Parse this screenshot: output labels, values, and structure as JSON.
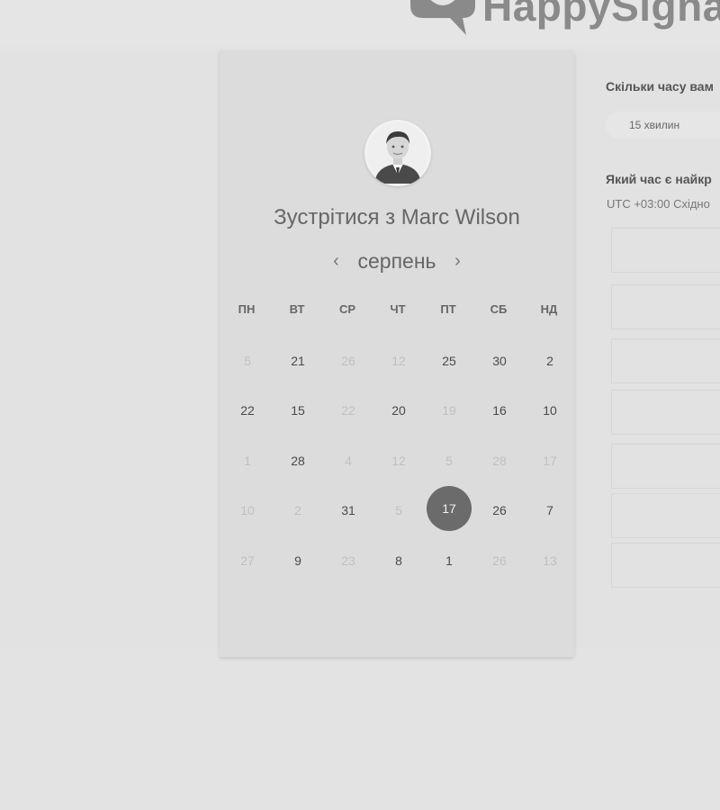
{
  "brand": {
    "name": "HappySignal"
  },
  "booking": {
    "title": "Зустрітися з Marc Wilson",
    "month": "серпень",
    "prev_icon": "‹",
    "next_icon": "›",
    "weekdays": [
      "ПН",
      "ВТ",
      "СР",
      "ЧТ",
      "ПТ",
      "СБ",
      "НД"
    ],
    "days": [
      {
        "label": "5",
        "available": false
      },
      {
        "label": "21",
        "available": true
      },
      {
        "label": "26",
        "available": false
      },
      {
        "label": "12",
        "available": false
      },
      {
        "label": "25",
        "available": true
      },
      {
        "label": "30",
        "available": true
      },
      {
        "label": "2",
        "available": true
      },
      {
        "label": "22",
        "available": true
      },
      {
        "label": "15",
        "available": true
      },
      {
        "label": "22",
        "available": false
      },
      {
        "label": "20",
        "available": true
      },
      {
        "label": "19",
        "available": false
      },
      {
        "label": "16",
        "available": true
      },
      {
        "label": "10",
        "available": true
      },
      {
        "label": "1",
        "available": false
      },
      {
        "label": "28",
        "available": true
      },
      {
        "label": "4",
        "available": false
      },
      {
        "label": "12",
        "available": false
      },
      {
        "label": "5",
        "available": false
      },
      {
        "label": "28",
        "available": false
      },
      {
        "label": "17",
        "available": false
      },
      {
        "label": "10",
        "available": false
      },
      {
        "label": "2",
        "available": false
      },
      {
        "label": "31",
        "available": true
      },
      {
        "label": "5",
        "available": false
      },
      {
        "label": "17",
        "available": true,
        "selected": true
      },
      {
        "label": "26",
        "available": true
      },
      {
        "label": "7",
        "available": true
      },
      {
        "label": "27",
        "available": false
      },
      {
        "label": "9",
        "available": true
      },
      {
        "label": "23",
        "available": false
      },
      {
        "label": "8",
        "available": true
      },
      {
        "label": "1",
        "available": true
      },
      {
        "label": "26",
        "available": false
      },
      {
        "label": "13",
        "available": false
      }
    ]
  },
  "side": {
    "duration_question": "Скільки часу вам",
    "duration_value": "15 хвилин",
    "time_question": "Який час є найкр",
    "timezone": "UTC +03:00 Східно",
    "time_slots": [
      "",
      "",
      "",
      "",
      "",
      "",
      ""
    ]
  },
  "colors": {
    "selected_day": "#6b6b6b",
    "card": "#dcdcdc",
    "page": "#e3e3e3"
  }
}
